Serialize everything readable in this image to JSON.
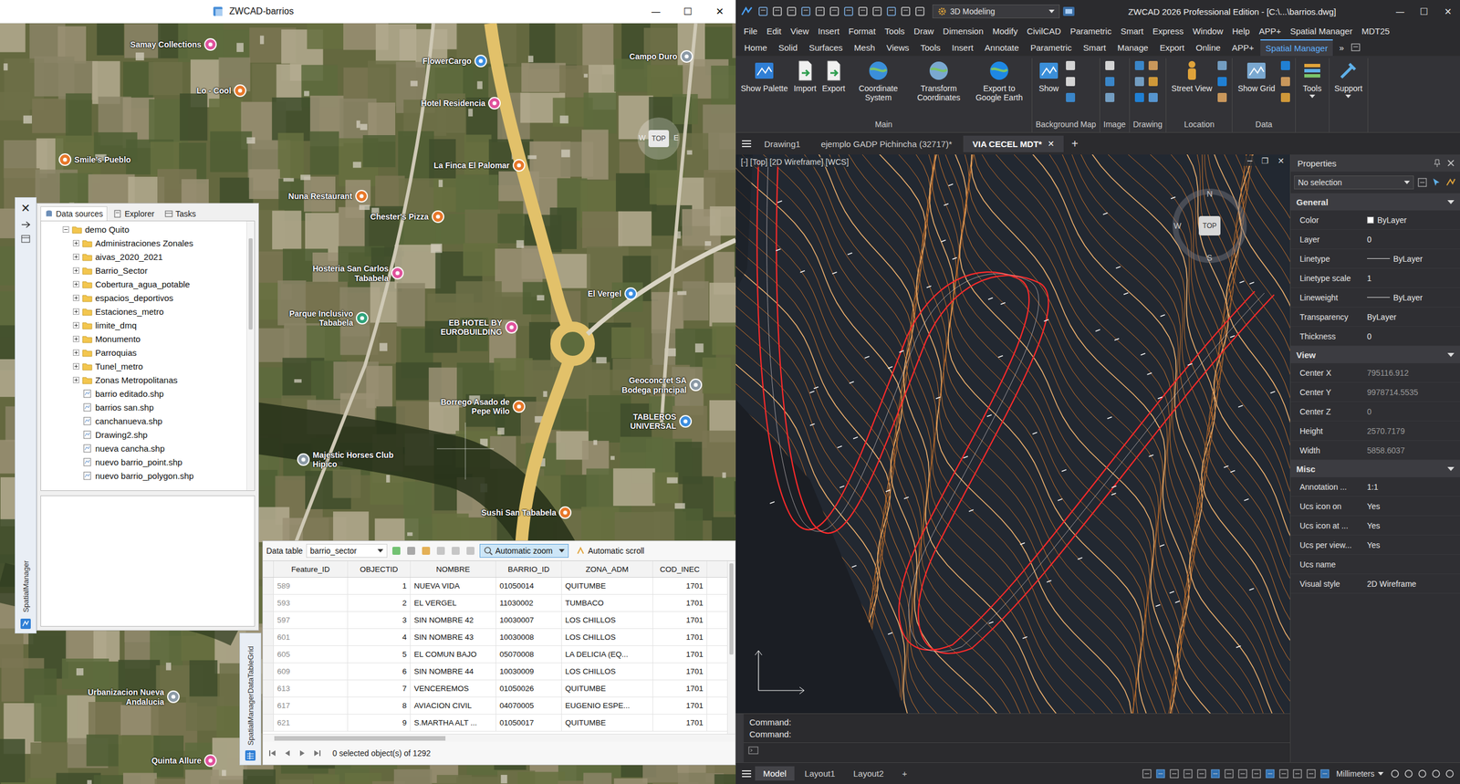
{
  "left_window": {
    "title": "ZWCAD-barrios",
    "controls": [
      "—",
      "☐",
      "✕"
    ]
  },
  "map": {
    "compass": {
      "center": "TOP",
      "west": "W",
      "east": "E"
    },
    "pois": [
      {
        "name": "Samay Collections",
        "color": "#e0529c"
      },
      {
        "name": "Lo - Cool",
        "color": "#e8782a"
      },
      {
        "name": "Smile's Pueblo",
        "color": "#e8782a"
      },
      {
        "name": "FlowerCargo",
        "color": "#3d8ee0"
      },
      {
        "name": "Campo Duro",
        "color": "#8c9aa6"
      },
      {
        "name": "Hotel Residencia",
        "color": "#e0529c"
      },
      {
        "name": "La Finca El Palomar",
        "color": "#e8782a"
      },
      {
        "name": "Nuna Restaurant",
        "color": "#e8782a"
      },
      {
        "name": "Chester's Pizza",
        "color": "#e8782a"
      },
      {
        "name": "Hosteria San Carlos Tababela",
        "color": "#e0529c"
      },
      {
        "name": "Parque Inclusivo Tababela",
        "color": "#2fa37a"
      },
      {
        "name": "EB HOTEL BY EUROBUILDING",
        "color": "#e0529c"
      },
      {
        "name": "El Vergel",
        "color": "#3d8ee0"
      },
      {
        "name": "Geoconcret SA Bodega principal",
        "color": "#8c9aa6"
      },
      {
        "name": "Borrego Asado de Pepe Wilo",
        "color": "#e8782a"
      },
      {
        "name": "TABLEROS UNIVERSAL",
        "color": "#3d8ee0"
      },
      {
        "name": "Majestic Horses Club Hipico",
        "color": "#8c9aa6"
      },
      {
        "name": "Sushi San Tababela",
        "color": "#e8782a"
      },
      {
        "name": "Urbanizacion Nueva Andalucia",
        "color": "#8c9aa6"
      },
      {
        "name": "Quinta Allure",
        "color": "#e0529c"
      }
    ]
  },
  "spatial_manager": {
    "close": "✕",
    "side_label": "SpatialManager",
    "tabs": [
      {
        "label": "Data sources",
        "selected": true
      },
      {
        "label": "Explorer",
        "selected": false
      },
      {
        "label": "Tasks",
        "selected": false
      }
    ],
    "tree": {
      "root": "demo Quito",
      "expanded": true,
      "items": [
        {
          "label": "Administraciones Zonales",
          "kind": "folder",
          "expanded": false
        },
        {
          "label": "aivas_2020_2021",
          "kind": "folder",
          "expanded": false
        },
        {
          "label": "Barrio_Sector",
          "kind": "folder",
          "expanded": false
        },
        {
          "label": "Cobertura_agua_potable",
          "kind": "folder",
          "expanded": false
        },
        {
          "label": "espacios_deportivos",
          "kind": "folder",
          "expanded": false
        },
        {
          "label": "Estaciones_metro",
          "kind": "folder",
          "expanded": false
        },
        {
          "label": "limite_dmq",
          "kind": "folder",
          "expanded": false
        },
        {
          "label": "Monumento",
          "kind": "folder",
          "expanded": false
        },
        {
          "label": "Parroquias",
          "kind": "folder",
          "expanded": false
        },
        {
          "label": "Tunel_metro",
          "kind": "folder",
          "expanded": false
        },
        {
          "label": "Zonas Metropolitanas",
          "kind": "folder",
          "expanded": false
        },
        {
          "label": "barrio editado.shp",
          "kind": "file",
          "expanded": false
        },
        {
          "label": "barrios san.shp",
          "kind": "file",
          "expanded": false
        },
        {
          "label": "canchanueva.shp",
          "kind": "file",
          "expanded": false
        },
        {
          "label": "Drawing2.shp",
          "kind": "file",
          "expanded": false
        },
        {
          "label": "nueva cancha.shp",
          "kind": "file",
          "expanded": false
        },
        {
          "label": "nuevo barrio_point.shp",
          "kind": "file",
          "expanded": false
        },
        {
          "label": "nuevo barrio_polygon.shp",
          "kind": "file",
          "expanded": false
        }
      ]
    }
  },
  "data_table": {
    "side_label": "SpatialManagerDataTableGrid",
    "label": "Data table",
    "table_name": "barrio_sector",
    "automatic_zoom": {
      "label": "Automatic zoom",
      "on": true
    },
    "automatic_scroll": {
      "label": "Automatic scroll",
      "on": false
    },
    "columns": [
      "Feature_ID",
      "OBJECTID",
      "NOMBRE",
      "BARRIO_ID",
      "ZONA_ADM",
      "COD_INEC"
    ],
    "rows": [
      [
        "589",
        "1",
        "NUEVA VIDA",
        "01050014",
        "QUITUMBE",
        "1701"
      ],
      [
        "593",
        "2",
        "EL VERGEL",
        "11030002",
        "TUMBACO",
        "1701"
      ],
      [
        "597",
        "3",
        "SIN NOMBRE 42",
        "10030007",
        "LOS CHILLOS",
        "1701"
      ],
      [
        "601",
        "4",
        "SIN NOMBRE 43",
        "10030008",
        "LOS CHILLOS",
        "1701"
      ],
      [
        "605",
        "5",
        "EL COMUN BAJO",
        "05070008",
        "LA DELICIA (EQ...",
        "1701"
      ],
      [
        "609",
        "6",
        "SIN NOMBRE 44",
        "10030009",
        "LOS CHILLOS",
        "1701"
      ],
      [
        "613",
        "7",
        "VENCEREMOS",
        "01050026",
        "QUITUMBE",
        "1701"
      ],
      [
        "617",
        "8",
        "AVIACION CIVIL",
        "04070005",
        "EUGENIO ESPE...",
        "1701"
      ],
      [
        "621",
        "9",
        "S.MARTHA ALT ...",
        "01050017",
        "QUITUMBE",
        "1701"
      ]
    ],
    "status": "0 selected object(s) of 1292"
  },
  "right_window": {
    "title": "ZWCAD 2026 Professional Edition - [C:\\...\\barrios.dwg]",
    "workspace": "3D Modeling",
    "controls": [
      "—",
      "☐",
      "✕"
    ]
  },
  "menu": [
    "File",
    "Edit",
    "View",
    "Insert",
    "Format",
    "Tools",
    "Draw",
    "Dimension",
    "Modify",
    "CivilCAD",
    "Parametric",
    "Smart",
    "Express",
    "Window",
    "Help",
    "APP+",
    "Spatial Manager",
    "MDT25"
  ],
  "ribbon_tabs": [
    {
      "label": "Home",
      "selected": false
    },
    {
      "label": "Solid",
      "selected": false
    },
    {
      "label": "Surfaces",
      "selected": false
    },
    {
      "label": "Mesh",
      "selected": false
    },
    {
      "label": "Views",
      "selected": false
    },
    {
      "label": "Tools",
      "selected": false
    },
    {
      "label": "Insert",
      "selected": false
    },
    {
      "label": "Annotate",
      "selected": false
    },
    {
      "label": "Parametric",
      "selected": false
    },
    {
      "label": "Smart",
      "selected": false
    },
    {
      "label": "Manage",
      "selected": false
    },
    {
      "label": "Export",
      "selected": false
    },
    {
      "label": "Online",
      "selected": false
    },
    {
      "label": "APP+",
      "selected": false
    },
    {
      "label": "Spatial Manager",
      "selected": true
    }
  ],
  "ribbon_overflow": "»",
  "ribbon_groups": [
    {
      "label": "Main",
      "buttons": [
        "Show Palette",
        "Import",
        "Export",
        "Coordinate System",
        "Transform Coordinates",
        "Export to Google Earth"
      ]
    },
    {
      "label": "Background Map",
      "buttons": [
        "Show"
      ]
    },
    {
      "label": "Image",
      "buttons": []
    },
    {
      "label": "Drawing",
      "buttons": []
    },
    {
      "label": "Location",
      "buttons": [
        "Street View"
      ]
    },
    {
      "label": "Data",
      "buttons": [
        "Show Grid"
      ]
    },
    {
      "label": "",
      "buttons": [
        "Tools"
      ]
    },
    {
      "label": "",
      "buttons": [
        "Support"
      ]
    }
  ],
  "doc_tabs": {
    "tabs": [
      {
        "label": "Drawing1",
        "selected": false
      },
      {
        "label": "ejemplo GADP Pichincha (32717)*",
        "selected": false
      },
      {
        "label": "VIA CECEL MDT*",
        "selected": true
      }
    ],
    "close": "✕",
    "add": "+"
  },
  "viewport": {
    "label": "[-] [Top] [2D Wireframe] [WCS]",
    "controls": [
      "─",
      "❐",
      "✕"
    ],
    "compass": {
      "center": "TOP",
      "north": "N",
      "south": "S",
      "west": "W"
    }
  },
  "properties": {
    "title": "Properties",
    "selection": "No selection",
    "sections": [
      {
        "title": "General",
        "expanded": true,
        "rows": [
          {
            "label": "Color",
            "value": "ByLayer",
            "kind": "swatch",
            "readonly": false
          },
          {
            "label": "Layer",
            "value": "0",
            "kind": "text",
            "readonly": false
          },
          {
            "label": "Linetype",
            "value": "ByLayer",
            "kind": "line",
            "readonly": false
          },
          {
            "label": "Linetype scale",
            "value": "1",
            "kind": "text",
            "readonly": false
          },
          {
            "label": "Lineweight",
            "value": "ByLayer",
            "kind": "line",
            "readonly": false
          },
          {
            "label": "Transparency",
            "value": "ByLayer",
            "kind": "text",
            "readonly": false
          },
          {
            "label": "Thickness",
            "value": "0",
            "kind": "text",
            "readonly": false
          }
        ]
      },
      {
        "title": "View",
        "expanded": true,
        "rows": [
          {
            "label": "Center X",
            "value": "795116.912",
            "kind": "text",
            "readonly": true
          },
          {
            "label": "Center Y",
            "value": "9978714.5535",
            "kind": "text",
            "readonly": true
          },
          {
            "label": "Center Z",
            "value": "0",
            "kind": "text",
            "readonly": true
          },
          {
            "label": "Height",
            "value": "2570.7179",
            "kind": "text",
            "readonly": true
          },
          {
            "label": "Width",
            "value": "5858.6037",
            "kind": "text",
            "readonly": true
          }
        ]
      },
      {
        "title": "Misc",
        "expanded": true,
        "rows": [
          {
            "label": "Annotation ...",
            "value": "1:1",
            "kind": "text",
            "readonly": false
          },
          {
            "label": "Ucs icon on",
            "value": "Yes",
            "kind": "text",
            "readonly": false
          },
          {
            "label": "Ucs icon at ...",
            "value": "Yes",
            "kind": "text",
            "readonly": false
          },
          {
            "label": "Ucs per view...",
            "value": "Yes",
            "kind": "text",
            "readonly": false
          },
          {
            "label": "Ucs name",
            "value": "",
            "kind": "text",
            "readonly": false
          },
          {
            "label": "Visual style",
            "value": "2D Wireframe",
            "kind": "text",
            "readonly": false
          }
        ]
      }
    ]
  },
  "command": {
    "lines": [
      "Command:",
      "Command:"
    ]
  },
  "status_bar": {
    "tabs": [
      {
        "label": "Model",
        "selected": true
      },
      {
        "label": "Layout1",
        "selected": false
      },
      {
        "label": "Layout2",
        "selected": false
      }
    ],
    "add": "+",
    "units": "Millimeters"
  }
}
